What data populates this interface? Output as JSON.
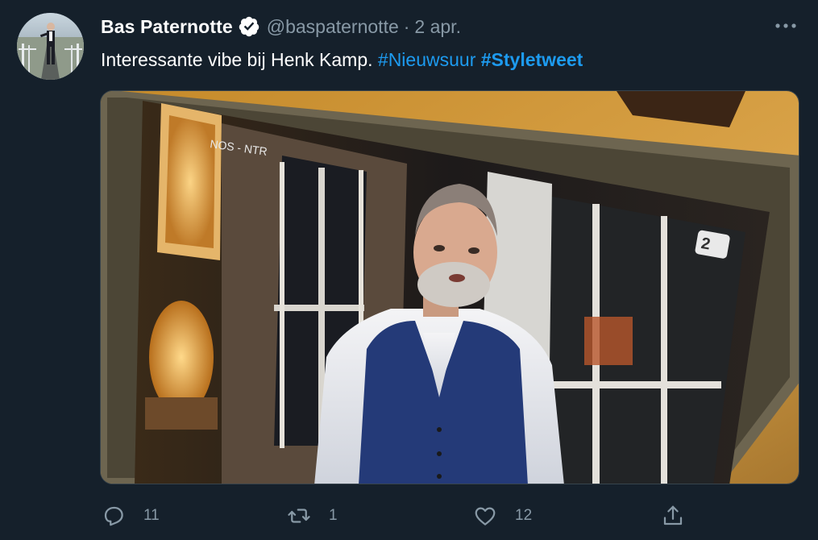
{
  "tweet": {
    "author": {
      "display_name": "Bas Paternotte",
      "handle": "@baspaternotte",
      "verified_icon": "verified-badge-icon"
    },
    "separator": "·",
    "date": "2 apr.",
    "text": {
      "plain": "Interessante vibe bij Henk Kamp.",
      "hashtags": [
        "#Nieuwsuur",
        "#Styletweet"
      ]
    },
    "media": {
      "overlay_caption": "NOS - NTR",
      "channel_logo": "npo-2-logo"
    },
    "actions": {
      "reply": {
        "icon": "reply-icon",
        "count": "11"
      },
      "retweet": {
        "icon": "retweet-icon",
        "count": "1"
      },
      "like": {
        "icon": "heart-icon",
        "count": "12"
      },
      "share": {
        "icon": "share-icon"
      }
    }
  },
  "colors": {
    "background": "#15202b",
    "primary_text": "#ffffff",
    "secondary_text": "#8899a6",
    "link": "#1d9bf0"
  }
}
